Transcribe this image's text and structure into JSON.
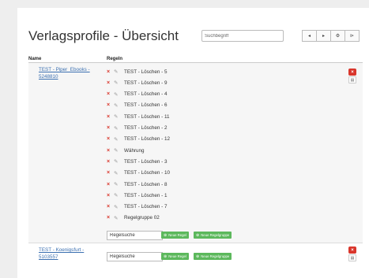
{
  "header": {
    "title": "Verlagsprofile - Übersicht",
    "search_placeholder": "Suchbegriff",
    "nav": [
      {
        "icon": "chevron-left-icon",
        "glyph": "◂"
      },
      {
        "icon": "chevron-right-icon",
        "glyph": "▸"
      },
      {
        "icon": "gear-icon",
        "glyph": "⚙"
      },
      {
        "icon": "folder-open-icon",
        "glyph": "⊳"
      }
    ]
  },
  "table": {
    "col_name": "Name",
    "col_rules": "Regeln"
  },
  "profiles": [
    {
      "name": "TEST - Piper_Ebooks - 5248810",
      "rules": [
        "TEST - Löschen - 5",
        "TEST - Löschen - 9",
        "TEST - Löschen - 4",
        "TEST - Löschen - 6",
        "TEST - Löschen - 11",
        "TEST - Löschen - 2",
        "TEST - Löschen - 12",
        "Währung",
        "TEST - Löschen - 3",
        "TEST - Löschen - 10",
        "TEST - Löschen - 8",
        "TEST - Löschen - 1",
        "TEST - Löschen - 7",
        "Regelgruppe 02"
      ],
      "rule_search_value": "Regelsuche"
    },
    {
      "name": "TEST - Koenigsfurt - 5103557",
      "rules": [],
      "rule_search_value": "Regelsuche"
    }
  ],
  "buttons": {
    "new_rule": "Neue Regel",
    "new_group": "Neue Regelgruppe"
  },
  "icons": {
    "delete_rule": "×",
    "edit_rule": "✎",
    "delete_profile": "×",
    "trash": "🗑"
  },
  "colors": {
    "link": "#3a6fb0",
    "danger": "#d9362c",
    "success": "#5cb85c"
  }
}
